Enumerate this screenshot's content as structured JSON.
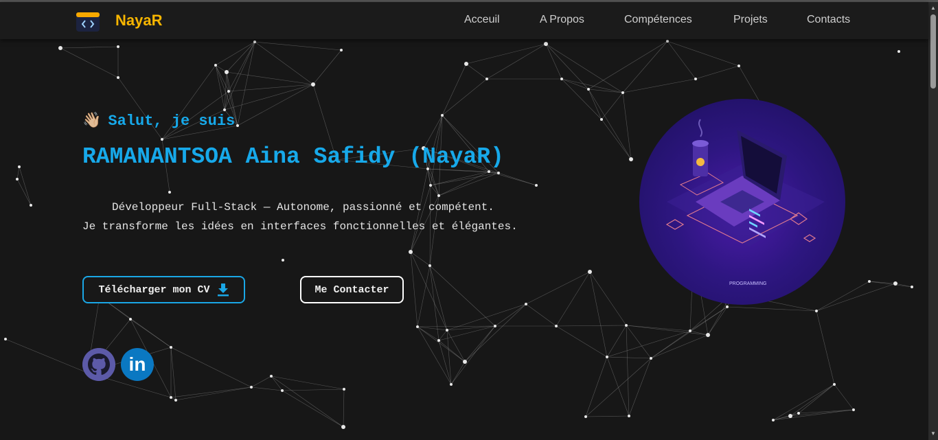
{
  "header": {
    "brand": "NayaR",
    "logo_icon": "code-window-icon",
    "nav": [
      "Acceuil",
      "A Propos",
      "Compétences",
      "Projets",
      "Contacts"
    ]
  },
  "hero": {
    "greeting_emoji": "👋🏼",
    "greeting": "Salut, je suis",
    "name": "RAMANANTSOA Aina Safidy (NayaR)",
    "description_line1": "Développeur Full-Stack — Autonome, passionné et compétent.",
    "description_line2": "Je transforme les idées en interfaces fonctionnelles et élégantes.",
    "cv_button": "Télécharger mon CV",
    "contact_button": "Me Contacter",
    "illustration_caption": "PROGRAMMING"
  },
  "social": {
    "github_icon": "github-icon",
    "linkedin_icon": "linkedin-icon",
    "linkedin_label": "in"
  },
  "colors": {
    "accent_blue": "#17a9ea",
    "brand_yellow": "#f7b500",
    "background": "#171717"
  }
}
